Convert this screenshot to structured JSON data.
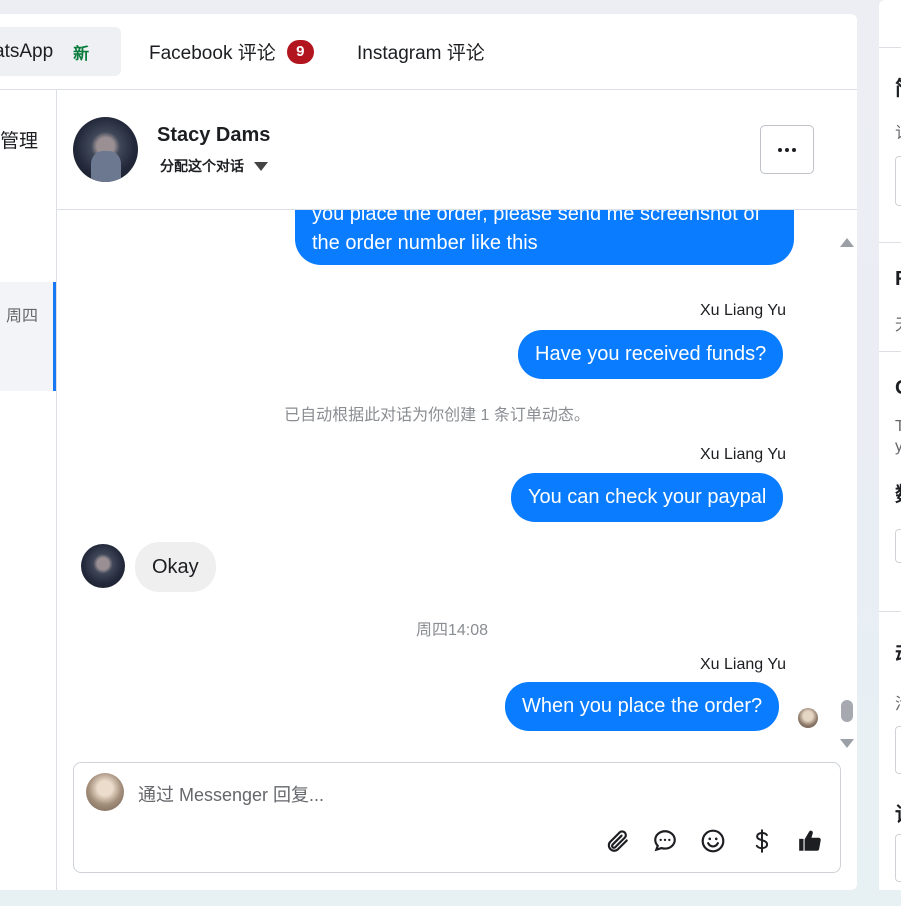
{
  "tabs": [
    {
      "label": "atsApp",
      "badge": "新"
    },
    {
      "label": "Facebook 评论",
      "count": "9"
    },
    {
      "label": "Instagram 评论"
    }
  ],
  "left_list": {
    "item_1": "管理",
    "selected_day": "周四"
  },
  "contact": {
    "name": "Stacy Dams",
    "assign_label": "分配这个对话"
  },
  "messages": {
    "bubble_1": "you place the order, please send me screenshot of the order number like this",
    "sender_1": "Xu Liang Yu",
    "bubble_2": "Have you received funds?",
    "system_note": "已自动根据此对话为你创建 1 条订单动态。",
    "sender_2": "Xu Liang Yu",
    "bubble_3": "You can check your paypal",
    "incoming": "Okay",
    "timestamp": "周四14:08",
    "sender_3": "Xu Liang Yu",
    "bubble_4": "When you place the order?"
  },
  "composer": {
    "placeholder": "通过 Messenger 回复..."
  },
  "colors": {
    "accent": "#0a7cff",
    "badge_red": "#b3151f",
    "new_green": "#0a7d3e"
  },
  "icons": [
    "attachment-icon",
    "chat-bubble-icon",
    "smiley-icon",
    "dollar-icon",
    "thumbs-up-icon"
  ]
}
